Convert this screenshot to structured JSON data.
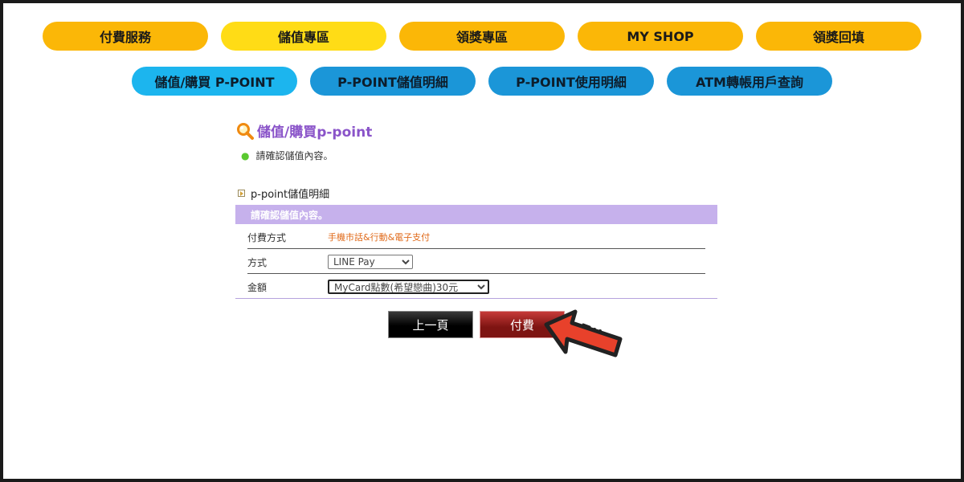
{
  "nav_top": [
    {
      "label": "付費服務",
      "active": false
    },
    {
      "label": "儲值專區",
      "active": true
    },
    {
      "label": "領獎專區",
      "active": false
    },
    {
      "label": "MY SHOP",
      "active": false
    },
    {
      "label": "領獎回填",
      "active": false
    }
  ],
  "nav_sub": [
    {
      "label": "儲值/購買 P-POINT",
      "active": true
    },
    {
      "label": "P-POINT儲值明細",
      "active": false
    },
    {
      "label": "P-POINT使用明細",
      "active": false
    },
    {
      "label": "ATM轉帳用戶查詢",
      "active": false
    }
  ],
  "page": {
    "title": "儲值/購買p-point",
    "hint": "請確認儲值內容。",
    "section_title": "p-point儲值明細",
    "table_header": "請確認儲值內容。"
  },
  "form": {
    "payment_label": "付費方式",
    "payment_value": "手機市話&行動&電子支付",
    "method_label": "方式",
    "method_value": "LINE Pay",
    "amount_label": "金額",
    "amount_value": "MyCard點數(希望戀曲)30元"
  },
  "buttons": {
    "prev": "上一頁",
    "pay": "付費"
  },
  "colors": {
    "nav_yellow": "#fbb707",
    "nav_yellow_active": "#ffdc16",
    "nav_blue": "#1b96d8",
    "nav_blue_active": "#1cb5ee",
    "title_purple": "#8a54c9",
    "table_header": "#c6b1ec",
    "arrow_red": "#e8412b"
  },
  "icons": {
    "title_icon": "magnifier-icon",
    "section_icon": "play-square-icon",
    "pointer": "pointing-arrow-icon"
  }
}
